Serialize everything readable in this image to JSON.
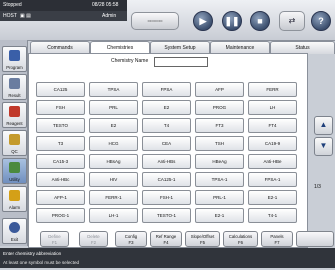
{
  "status": {
    "state": "Stopped",
    "datetime": "08/28 05:58",
    "host": "HOST",
    "user": "Admin"
  },
  "toolbar": {
    "tray_label": "",
    "run_icon": "play-icon",
    "pause_icon": "pause-icon",
    "stop_icon": "stop-icon",
    "logout_icon": "logout-icon",
    "help_label": "?"
  },
  "sidebar": {
    "items": [
      {
        "label": "Program",
        "icon": "program-icon",
        "color": "#3a5fa8"
      },
      {
        "label": "Result",
        "icon": "result-icon",
        "color": "#6a7da0"
      },
      {
        "label": "Reagent",
        "icon": "reagent-icon",
        "color": "#c0392b"
      },
      {
        "label": "QC",
        "icon": "qc-icon",
        "color": "#c49a2c"
      },
      {
        "label": "Utility",
        "icon": "utility-icon",
        "color": "#4b8a3e"
      },
      {
        "label": "Alarm",
        "icon": "alarm-icon",
        "color": "#d4a017"
      },
      {
        "label": "Exit",
        "icon": "exit-icon",
        "color": "#3b5a9a"
      }
    ]
  },
  "tabs": [
    "Commands",
    "Chemistries",
    "System Setup",
    "Maintenance",
    "Status"
  ],
  "active_tab": "Chemistries",
  "chemistry_name": {
    "label": "Chemistry Name",
    "value": ""
  },
  "chemistries": [
    [
      "CA125",
      "TPSA",
      "FPSA",
      "AFP",
      "FERR"
    ],
    [
      "FSH",
      "PRL",
      "E2",
      "PROG",
      "LH"
    ],
    [
      "TESTO",
      "E2",
      "T4",
      "FT3",
      "FT4"
    ],
    [
      "T3",
      "HCG",
      "CEA",
      "TSH",
      "CA19-9"
    ],
    [
      "CA15-3",
      "HBsAg",
      "Anti-HBs",
      "HBeAg",
      "Anti-HBe"
    ],
    [
      "Anti-HBc",
      "HIV",
      "CA125-1",
      "TPSA-1",
      "FPSA-1"
    ],
    [
      "AFP-1",
      "FERR-1",
      "FSH-1",
      "PRL-1",
      "E2-1"
    ],
    [
      "PROG-1",
      "LH-1",
      "TESTO-1",
      "E2-1",
      "T4-1"
    ]
  ],
  "page": "1/3",
  "functions": [
    {
      "label": "Define",
      "key": "F1",
      "enabled": false
    },
    {
      "label": "Delete",
      "key": "F2",
      "enabled": false
    },
    {
      "label": "Config",
      "key": "F3",
      "enabled": true
    },
    {
      "label": "Ref Range",
      "key": "F4",
      "enabled": true
    },
    {
      "label": "Slope/Offset",
      "key": "F5",
      "enabled": true
    },
    {
      "label": "Calculations",
      "key": "F6",
      "enabled": true
    },
    {
      "label": "Panels",
      "key": "F7",
      "enabled": true
    }
  ],
  "messages": [
    "Enter chemistry abbreviation",
    "At least one symbol must be selected"
  ]
}
